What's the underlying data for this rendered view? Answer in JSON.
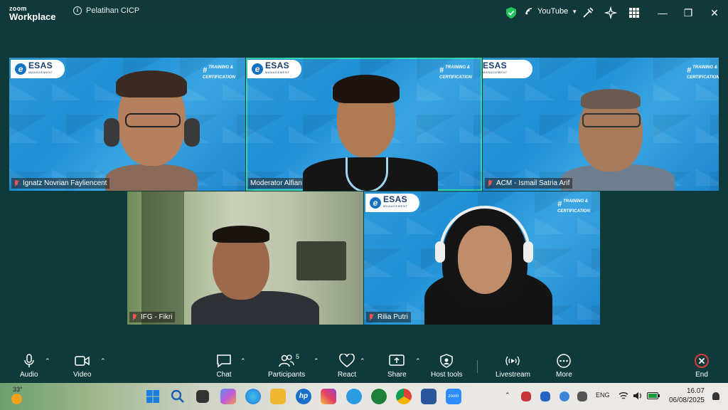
{
  "app": {
    "logo_line1": "zoom",
    "logo_line2": "Workplace",
    "meeting_title": "Pelatihan CICP"
  },
  "titlebar": {
    "stream_label": "YouTube"
  },
  "brand": {
    "name": "ESAS",
    "sub": "MANAGEMENT",
    "tagline1": "TRAINING &",
    "tagline2": "CERTIFICATION"
  },
  "participants": [
    {
      "name": "Ignatz Novrian Fayliencent",
      "muted": true
    },
    {
      "name": "Moderator Alfian",
      "muted": false
    },
    {
      "name": "ACM - Ismail Satria Arif",
      "muted": true
    },
    {
      "name": "IFG - Fikri",
      "muted": true
    },
    {
      "name": "Rilia Putri",
      "muted": true
    }
  ],
  "toolbar": {
    "audio": "Audio",
    "video": "Video",
    "chat": "Chat",
    "participants": "Participants",
    "participants_count": "5",
    "react": "React",
    "share": "Share",
    "host_tools": "Host tools",
    "livestream": "Livestream",
    "more": "More",
    "end": "End"
  },
  "taskbar": {
    "temperature": "33°",
    "language": "ENG",
    "time": "16.07",
    "date": "06/08/2025"
  },
  "colors": {
    "active_speaker": "#35d6b0",
    "end_red": "#e0393e",
    "titlebar": "#11393a"
  }
}
